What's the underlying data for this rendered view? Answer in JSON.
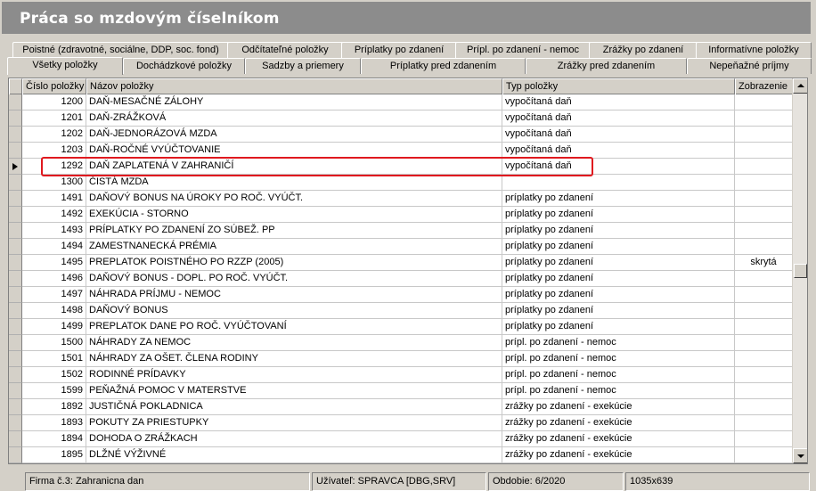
{
  "window": {
    "title": "Práca so mzdovým číselníkom"
  },
  "tabs_row1": [
    "Poistné (zdravotné, sociálne, DDP, soc. fond)",
    "Odčítateľné položky",
    "Príplatky po zdanení",
    "Prípl. po zdanení - nemoc",
    "Zrážky po zdanení",
    "Informatívne položky"
  ],
  "tabs_row2": [
    "Všetky položky",
    "Dochádzkové položky",
    "Sadzby a priemery",
    "Príplatky pred zdanením",
    "Zrážky pred zdanením",
    "Nepeňažné príjmy"
  ],
  "active_tab": "Všetky položky",
  "grid": {
    "columns": [
      "Číslo položky",
      "Názov položky",
      "Typ položky",
      "Zobrazenie"
    ],
    "current_row": "1292",
    "highlighted_row": "1292",
    "rows": [
      {
        "num": "1200",
        "name": "DAŇ-MESAČNÉ ZÁLOHY",
        "type": "vypočítaná daň",
        "vis": ""
      },
      {
        "num": "1201",
        "name": "DAŇ-ZRÁŽKOVÁ",
        "type": "vypočítaná daň",
        "vis": ""
      },
      {
        "num": "1202",
        "name": "DAŇ-JEDNORÁZOVÁ MZDA",
        "type": "vypočítaná daň",
        "vis": ""
      },
      {
        "num": "1203",
        "name": "DAŇ-ROČNÉ VYÚČTOVANIE",
        "type": "vypočítaná daň",
        "vis": ""
      },
      {
        "num": "1292",
        "name": "DAŇ ZAPLATENÁ V ZAHRANIČÍ",
        "type": "vypočítaná daň",
        "vis": ""
      },
      {
        "num": "1300",
        "name": "ČISTÁ MZDA",
        "type": "",
        "vis": ""
      },
      {
        "num": "1491",
        "name": "DAŇOVÝ BONUS NA ÚROKY  PO ROČ. VYÚČT.",
        "type": "príplatky po zdanení",
        "vis": ""
      },
      {
        "num": "1492",
        "name": "EXEKÚCIA - STORNO",
        "type": "príplatky po zdanení",
        "vis": ""
      },
      {
        "num": "1493",
        "name": "PRÍPLATKY PO ZDANENÍ ZO SÚBEŽ. PP",
        "type": "príplatky po zdanení",
        "vis": ""
      },
      {
        "num": "1494",
        "name": "ZAMESTNANECKÁ PRÉMIA",
        "type": "príplatky po zdanení",
        "vis": ""
      },
      {
        "num": "1495",
        "name": "PREPLATOK POISTNÉHO PO RZZP (2005)",
        "type": "príplatky po zdanení",
        "vis": "skrytá"
      },
      {
        "num": "1496",
        "name": "DAŇOVÝ BONUS - DOPL. PO ROČ. VYÚČT.",
        "type": "príplatky po zdanení",
        "vis": ""
      },
      {
        "num": "1497",
        "name": "NÁHRADA PRÍJMU - NEMOC",
        "type": "príplatky po zdanení",
        "vis": ""
      },
      {
        "num": "1498",
        "name": "DAŇOVÝ BONUS",
        "type": "príplatky po zdanení",
        "vis": ""
      },
      {
        "num": "1499",
        "name": "PREPLATOK DANE PO ROČ. VYÚČTOVANÍ",
        "type": "príplatky po zdanení",
        "vis": ""
      },
      {
        "num": "1500",
        "name": "NÁHRADY ZA NEMOC",
        "type": "prípl. po zdanení - nemoc",
        "vis": ""
      },
      {
        "num": "1501",
        "name": "NÁHRADY ZA OŠET. ČLENA RODINY",
        "type": "prípl. po zdanení - nemoc",
        "vis": ""
      },
      {
        "num": "1502",
        "name": "RODINNÉ PRÍDAVKY",
        "type": "prípl. po zdanení - nemoc",
        "vis": ""
      },
      {
        "num": "1599",
        "name": "PEŇAŽNÁ POMOC V MATERSTVE",
        "type": "prípl. po zdanení - nemoc",
        "vis": ""
      },
      {
        "num": "1892",
        "name": "JUSTIČNÁ POKLADNICA",
        "type": "zrážky po zdanení - exekúcie",
        "vis": ""
      },
      {
        "num": "1893",
        "name": "POKUTY ZA PRIESTUPKY",
        "type": "zrážky po zdanení - exekúcie",
        "vis": ""
      },
      {
        "num": "1894",
        "name": "DOHODA O ZRÁŽKACH",
        "type": "zrážky po zdanení - exekúcie",
        "vis": ""
      },
      {
        "num": "1895",
        "name": "DLŽNÉ VÝŽIVNÉ",
        "type": "zrážky po zdanení - exekúcie",
        "vis": ""
      }
    ]
  },
  "status": {
    "firma": "Firma č.3: Zahranicna dan",
    "user": "Užívateľ: SPRAVCA [DBG,SRV]",
    "period": "Obdobie: 6/2020",
    "resolution": "1035x639"
  },
  "colors": {
    "title_bg": "#8c8c8c",
    "highlight_box": "#e0191f",
    "window_bg": "#d4d0c8"
  }
}
